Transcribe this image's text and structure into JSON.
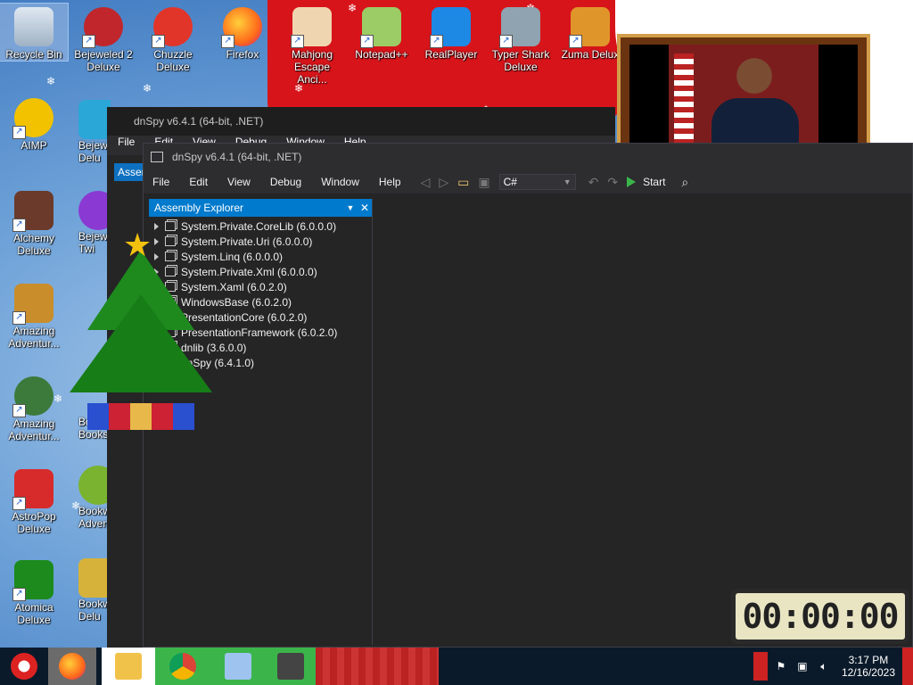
{
  "desktop": {
    "icons": [
      {
        "label": "Recycle Bin"
      },
      {
        "label": "Bejeweled 2 Deluxe"
      },
      {
        "label": "Chuzzle Deluxe"
      },
      {
        "label": "Firefox"
      },
      {
        "label": "Mahjong Escape Anci..."
      },
      {
        "label": "Notepad++"
      },
      {
        "label": "RealPlayer"
      },
      {
        "label": "Typer Shark Deluxe"
      },
      {
        "label": "Zuma Delux"
      },
      {
        "label": "AIMP"
      },
      {
        "label": "Bejew Delu"
      },
      {
        "label": "Alchemy Deluxe"
      },
      {
        "label": "Bejew Twi"
      },
      {
        "label": "Amazing Adventur..."
      },
      {
        "label": "Bi"
      },
      {
        "label": "Amazing Adventur..."
      },
      {
        "label": "Bo Books"
      },
      {
        "label": "AstroPop Deluxe"
      },
      {
        "label": "Bookw Adven"
      },
      {
        "label": "Atomica Deluxe"
      },
      {
        "label": "Bookw Delu"
      }
    ]
  },
  "back_window": {
    "title": "dnSpy v6.4.1 (64-bit, .NET)",
    "menu": [
      "File",
      "Edit",
      "View",
      "Debug",
      "Window",
      "Help"
    ],
    "lang": "C#",
    "panel_label": "Assem"
  },
  "window": {
    "title": "dnSpy v6.4.1 (64-bit, .NET)",
    "menu": {
      "file": "File",
      "edit": "Edit",
      "view": "View",
      "debug": "Debug",
      "window": "Window",
      "help": "Help"
    },
    "language": "C#",
    "start_label": "Start"
  },
  "assembly_explorer": {
    "title": "Assembly Explorer",
    "items": [
      {
        "label": "System.Private.CoreLib (6.0.0.0)"
      },
      {
        "label": "System.Private.Uri (6.0.0.0)"
      },
      {
        "label": "System.Linq (6.0.0.0)"
      },
      {
        "label": "System.Private.Xml (6.0.0.0)"
      },
      {
        "label": "System.Xaml (6.0.2.0)"
      },
      {
        "label": "WindowsBase (6.0.2.0)"
      },
      {
        "label": "PresentationCore (6.0.2.0)"
      },
      {
        "label": "PresentationFramework (6.0.2.0)"
      },
      {
        "label": "dnlib (3.6.0.0)"
      },
      {
        "label": "dnSpy (6.4.1.0)"
      }
    ]
  },
  "timer": {
    "display": "00:00:00"
  },
  "taskbar": {
    "time": "3:17 PM",
    "date": "12/16/2023"
  },
  "colors": {
    "accent": "#007acc",
    "window_bg": "#252526",
    "start_green": "#3ab54a"
  }
}
